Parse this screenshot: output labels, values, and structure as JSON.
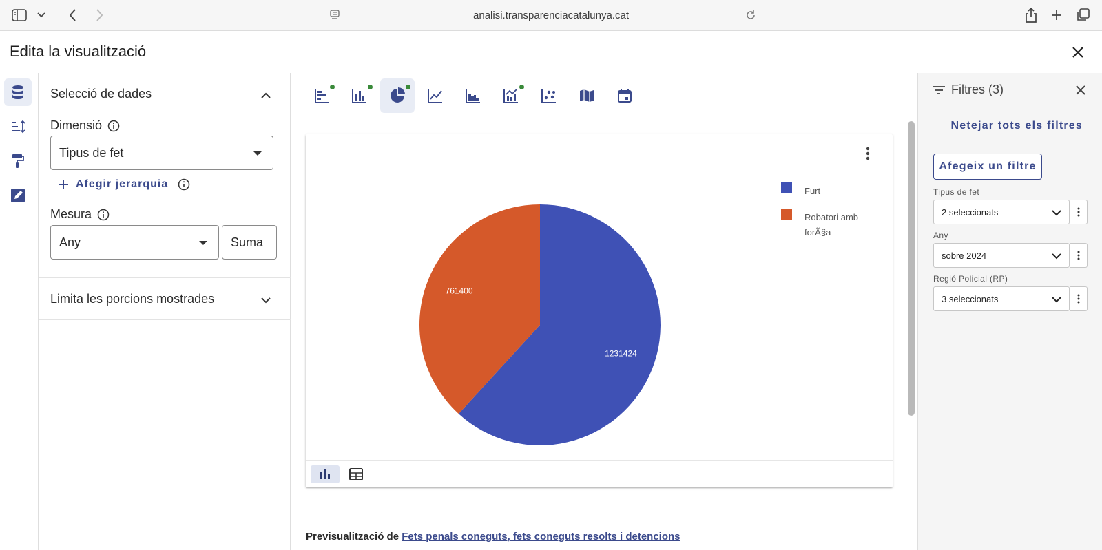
{
  "browser": {
    "url": "analisi.transparenciacatalunya.cat",
    "icons": [
      "sidebar-icon",
      "chevron-down-icon",
      "back-icon",
      "forward-icon",
      "reader-icon",
      "reload-icon",
      "share-icon",
      "new-tab-icon",
      "tabs-icon"
    ]
  },
  "dialog": {
    "title": "Edita la visualització"
  },
  "rail": {
    "items": [
      "database-icon",
      "sort-icon",
      "paint-roller-icon",
      "edit-note-icon"
    ],
    "active": 0
  },
  "data_selection": {
    "title": "Selecció de dades",
    "dimension_label": "Dimensió",
    "dimension_value": "Tipus de fet",
    "add_hierarchy": "Afegir jerarquia",
    "measure_label": "Mesura",
    "measure_value": "Any",
    "aggregation": "Suma",
    "limit_title": "Limita les porcions mostrades"
  },
  "chart_types": [
    {
      "icon": "horizontal-bar-icon",
      "dot": true
    },
    {
      "icon": "column-chart-icon",
      "dot": true
    },
    {
      "icon": "pie-chart-icon",
      "dot": true,
      "active": true
    },
    {
      "icon": "line-chart-icon",
      "dot": false
    },
    {
      "icon": "area-chart-icon",
      "dot": false
    },
    {
      "icon": "combo-chart-icon",
      "dot": true
    },
    {
      "icon": "scatter-chart-icon",
      "dot": false
    },
    {
      "icon": "map-icon",
      "dot": false
    },
    {
      "icon": "calendar-icon",
      "dot": false
    }
  ],
  "chart_data": {
    "type": "pie",
    "categories": [
      "Furt",
      "Robatori amb forÃ§a"
    ],
    "values": [
      1231424,
      761400
    ],
    "colors": [
      "#3f51b5",
      "#d5592a"
    ],
    "legend_position": "right"
  },
  "preview": {
    "prefix": "Previsualització de",
    "link": "Fets penals coneguts, fets coneguts resolts i detencions"
  },
  "filters": {
    "title": "Filtres (3)",
    "clear_all": "Netejar tots els filtres",
    "add_filter": "Afegeix un filtre",
    "items": [
      {
        "label": "Tipus de fet",
        "value": "2 seleccionats"
      },
      {
        "label": "Any",
        "value": "sobre 2024"
      },
      {
        "label": "Regió Policial (RP)",
        "value": "3 seleccionats"
      }
    ]
  }
}
